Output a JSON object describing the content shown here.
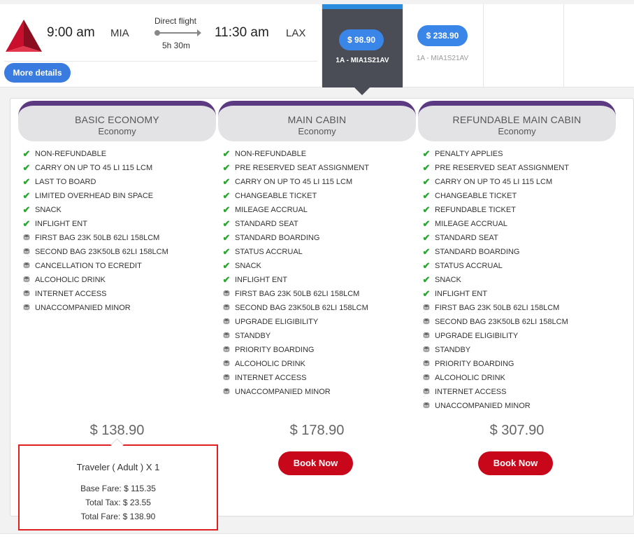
{
  "flight": {
    "departure_time": "9:00 am",
    "departure_code": "MIA",
    "route_type": "Direct flight",
    "duration": "5h 30m",
    "arrival_time": "11:30 am",
    "arrival_code": "LAX",
    "more_details_label": "More details",
    "logo_icon": "airline-triangle-logo"
  },
  "fare_columns": [
    {
      "price": "$ 98.90",
      "code": "1A - MIA1S21AV",
      "selected": true
    },
    {
      "price": "$ 238.90",
      "code": "1A - MIA1S21AV",
      "selected": false
    }
  ],
  "fares": [
    {
      "name": "BASIC ECONOMY",
      "cabin": "Economy",
      "price": "$ 138.90",
      "features": [
        {
          "label": "NON-REFUNDABLE",
          "icon": "check-icon"
        },
        {
          "label": "CARRY ON UP TO 45 LI 115 LCM",
          "icon": "check-icon"
        },
        {
          "label": "LAST TO BOARD",
          "icon": "check-icon"
        },
        {
          "label": "LIMITED OVERHEAD BIN SPACE",
          "icon": "check-icon"
        },
        {
          "label": "SNACK",
          "icon": "check-icon"
        },
        {
          "label": "INFLIGHT ENT",
          "icon": "check-icon"
        },
        {
          "label": "FIRST BAG 23K 50LB 62LI 158LCM",
          "icon": "money-icon"
        },
        {
          "label": "SECOND BAG 23K50LB 62LI 158LCM",
          "icon": "money-icon"
        },
        {
          "label": "CANCELLATION TO ECREDIT",
          "icon": "money-icon"
        },
        {
          "label": "ALCOHOLIC DRINK",
          "icon": "money-icon"
        },
        {
          "label": "INTERNET ACCESS",
          "icon": "money-icon"
        },
        {
          "label": "UNACCOMPANIED MINOR",
          "icon": "money-icon"
        }
      ]
    },
    {
      "name": "MAIN CABIN",
      "cabin": "Economy",
      "price": "$ 178.90",
      "book_label": "Book Now",
      "features": [
        {
          "label": "NON-REFUNDABLE",
          "icon": "check-icon"
        },
        {
          "label": "PRE RESERVED SEAT ASSIGNMENT",
          "icon": "check-icon"
        },
        {
          "label": "CARRY ON UP TO 45 LI 115 LCM",
          "icon": "check-icon"
        },
        {
          "label": "CHANGEABLE TICKET",
          "icon": "check-icon"
        },
        {
          "label": "MILEAGE ACCRUAL",
          "icon": "check-icon"
        },
        {
          "label": "STANDARD SEAT",
          "icon": "check-icon"
        },
        {
          "label": "STANDARD BOARDING",
          "icon": "check-icon"
        },
        {
          "label": "STATUS ACCRUAL",
          "icon": "check-icon"
        },
        {
          "label": "SNACK",
          "icon": "check-icon"
        },
        {
          "label": "INFLIGHT ENT",
          "icon": "check-icon"
        },
        {
          "label": "FIRST BAG 23K 50LB 62LI 158LCM",
          "icon": "money-icon"
        },
        {
          "label": "SECOND BAG 23K50LB 62LI 158LCM",
          "icon": "money-icon"
        },
        {
          "label": "UPGRADE ELIGIBILITY",
          "icon": "money-icon"
        },
        {
          "label": "STANDBY",
          "icon": "money-icon"
        },
        {
          "label": "PRIORITY BOARDING",
          "icon": "money-icon"
        },
        {
          "label": "ALCOHOLIC DRINK",
          "icon": "money-icon"
        },
        {
          "label": "INTERNET ACCESS",
          "icon": "money-icon"
        },
        {
          "label": "UNACCOMPANIED MINOR",
          "icon": "money-icon"
        }
      ]
    },
    {
      "name": "REFUNDABLE MAIN CABIN",
      "cabin": "Economy",
      "price": "$ 307.90",
      "book_label": "Book Now",
      "features": [
        {
          "label": "PENALTY APPLIES",
          "icon": "check-icon"
        },
        {
          "label": "PRE RESERVED SEAT ASSIGNMENT",
          "icon": "check-icon"
        },
        {
          "label": "CARRY ON UP TO 45 LI 115 LCM",
          "icon": "check-icon"
        },
        {
          "label": "CHANGEABLE TICKET",
          "icon": "check-icon"
        },
        {
          "label": "REFUNDABLE TICKET",
          "icon": "check-icon"
        },
        {
          "label": "MILEAGE ACCRUAL",
          "icon": "check-icon"
        },
        {
          "label": "STANDARD SEAT",
          "icon": "check-icon"
        },
        {
          "label": "STANDARD BOARDING",
          "icon": "check-icon"
        },
        {
          "label": "STATUS ACCRUAL",
          "icon": "check-icon"
        },
        {
          "label": "SNACK",
          "icon": "check-icon"
        },
        {
          "label": "INFLIGHT ENT",
          "icon": "check-icon"
        },
        {
          "label": "FIRST BAG 23K 50LB 62LI 158LCM",
          "icon": "money-icon"
        },
        {
          "label": "SECOND BAG 23K50LB 62LI 158LCM",
          "icon": "money-icon"
        },
        {
          "label": "UPGRADE ELIGIBILITY",
          "icon": "money-icon"
        },
        {
          "label": "STANDBY",
          "icon": "money-icon"
        },
        {
          "label": "PRIORITY BOARDING",
          "icon": "money-icon"
        },
        {
          "label": "ALCOHOLIC DRINK",
          "icon": "money-icon"
        },
        {
          "label": "INTERNET ACCESS",
          "icon": "money-icon"
        },
        {
          "label": "UNACCOMPANIED MINOR",
          "icon": "money-icon"
        }
      ]
    }
  ],
  "price_breakdown": {
    "traveler": "Traveler ( Adult ) X 1",
    "base_fare": "Base Fare: $ 115.35",
    "total_tax": "Total Tax: $ 23.55",
    "total_fare": "Total Fare: $ 138.90"
  },
  "colors": {
    "accent_blue": "#3a7be0",
    "book_red": "#c8071b",
    "tab_purple": "#5b3a82",
    "check_green": "#27a82f",
    "highlight_red": "#e02020"
  }
}
